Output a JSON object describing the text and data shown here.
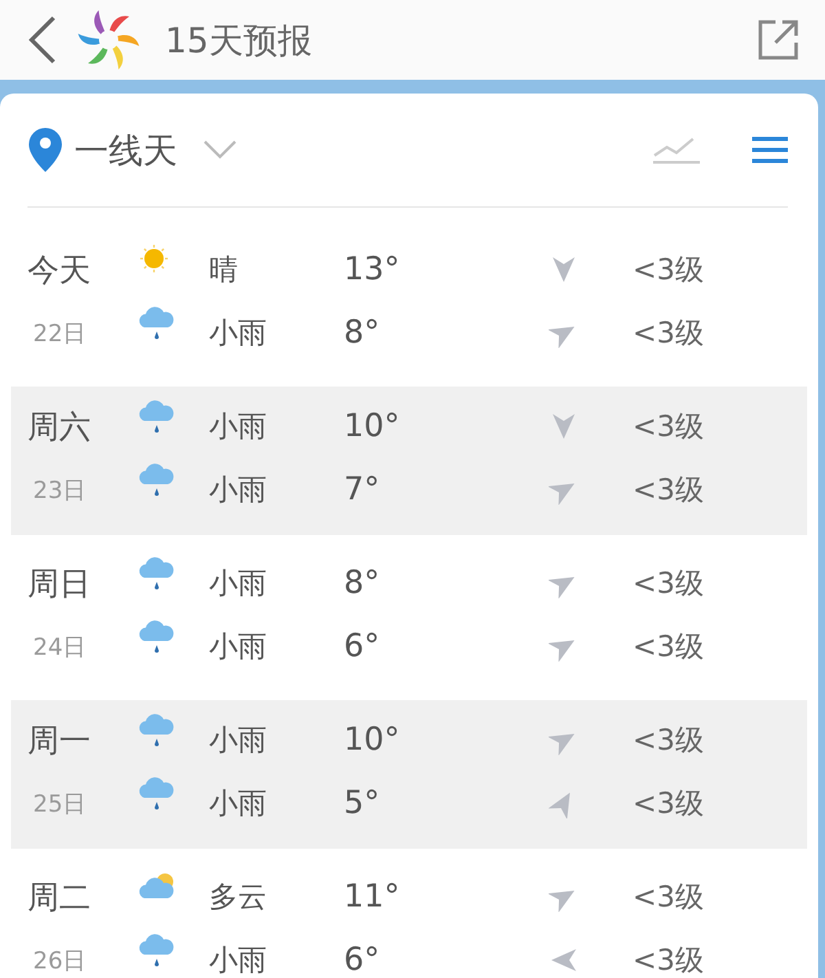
{
  "header": {
    "title": "15天预报"
  },
  "location": {
    "name": "一线天"
  },
  "days": [
    {
      "label": "今天",
      "date": "22日",
      "periods": [
        {
          "kind": "sun",
          "weather": "晴",
          "temp": "13°",
          "wind_arrow": {
            "kind": "down"
          },
          "wind": "<3级"
        },
        {
          "kind": "rain",
          "weather": "小雨",
          "temp": "8°",
          "wind_arrow": {
            "kind": "right"
          },
          "wind": "<3级"
        }
      ]
    },
    {
      "label": "周六",
      "date": "23日",
      "periods": [
        {
          "kind": "rain",
          "weather": "小雨",
          "temp": "10°",
          "wind_arrow": {
            "kind": "down"
          },
          "wind": "<3级"
        },
        {
          "kind": "rain",
          "weather": "小雨",
          "temp": "7°",
          "wind_arrow": {
            "kind": "right"
          },
          "wind": "<3级"
        }
      ]
    },
    {
      "label": "周日",
      "date": "24日",
      "periods": [
        {
          "kind": "rain",
          "weather": "小雨",
          "temp": "8°",
          "wind_arrow": {
            "kind": "right"
          },
          "wind": "<3级"
        },
        {
          "kind": "rain",
          "weather": "小雨",
          "temp": "6°",
          "wind_arrow": {
            "kind": "right"
          },
          "wind": "<3级"
        }
      ]
    },
    {
      "label": "周一",
      "date": "25日",
      "periods": [
        {
          "kind": "rain",
          "weather": "小雨",
          "temp": "10°",
          "wind_arrow": {
            "kind": "right"
          },
          "wind": "<3级"
        },
        {
          "kind": "rain",
          "weather": "小雨",
          "temp": "5°",
          "wind_arrow": {
            "kind": "upright"
          },
          "wind": "<3级"
        }
      ]
    },
    {
      "label": "周二",
      "date": "26日",
      "periods": [
        {
          "kind": "cloudy",
          "weather": "多云",
          "temp": "11°",
          "wind_arrow": {
            "kind": "right"
          },
          "wind": "<3级"
        },
        {
          "kind": "rain",
          "weather": "小雨",
          "temp": "6°",
          "wind_arrow": {
            "kind": "left"
          },
          "wind": "<3级"
        }
      ]
    }
  ]
}
